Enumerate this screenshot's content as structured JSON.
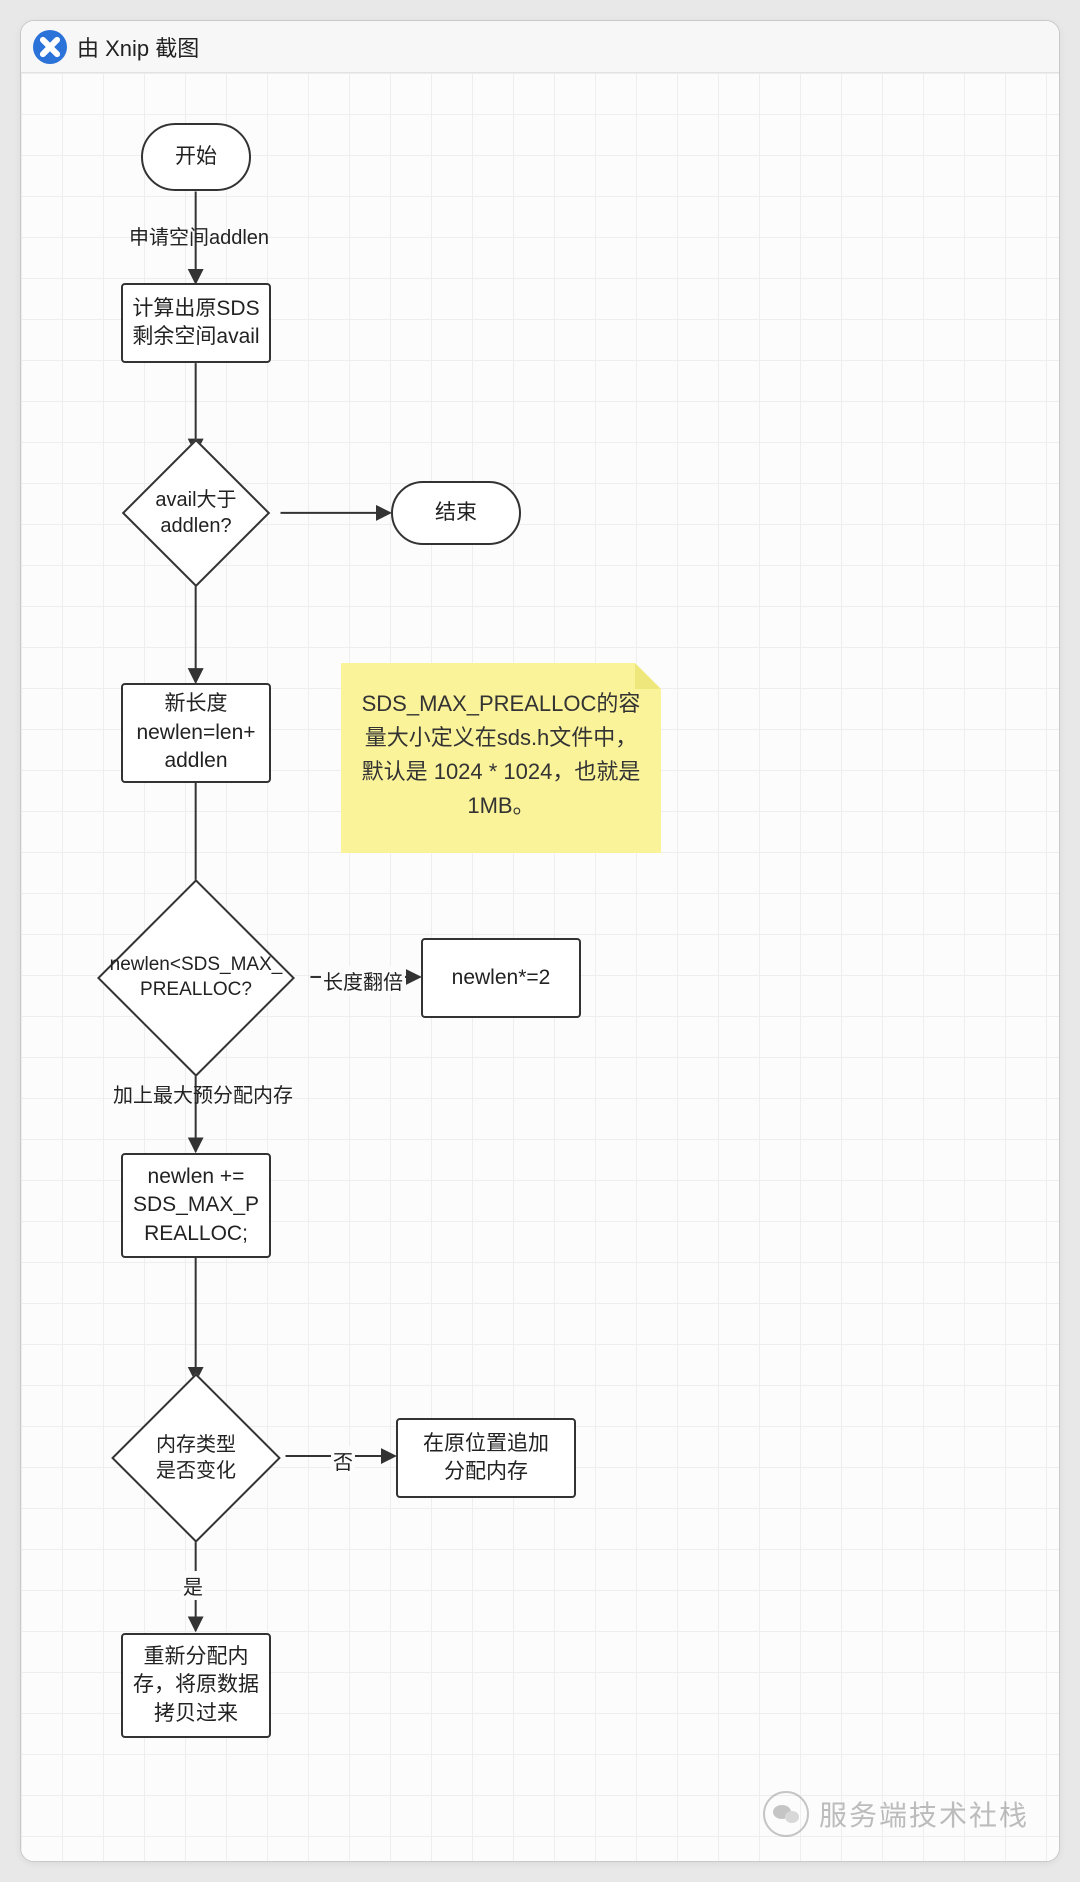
{
  "app": {
    "title": "由 Xnip 截图",
    "icon_name": "xnip-scissors-icon"
  },
  "nodes": {
    "start": "开始",
    "end": "结束",
    "calc_avail": "计算出原SDS\n剩余空间avail",
    "newlen_assign": "新长度\nnewlen=len+\naddlen",
    "newlen_double": "newlen*=2",
    "newlen_add_prealloc": "newlen +=\nSDS_MAX_P\nREALLOC;",
    "realloc_inplace": "在原位置追加\n分配内存",
    "realloc_new": "重新分配内\n存，将原数据\n拷贝过来"
  },
  "decisions": {
    "avail_gt_addlen": "avail大于\naddlen?",
    "newlen_lt_max": "newlen<SDS_MAX_\nPREALLOC?",
    "memtype_changed": "内存类型\n是否变化"
  },
  "edge_labels": {
    "apply_addlen": "申请空间addlen",
    "double_len": "长度翻倍",
    "add_max_prealloc": "加上最大预分配内存",
    "no": "否",
    "yes": "是"
  },
  "note": {
    "text": "SDS_MAX_PREALLOC的容量大小定义在sds.h文件中，默认是 1024 * 1024，也就是1MB。"
  },
  "watermark": {
    "text": "服务端技术社栈"
  }
}
